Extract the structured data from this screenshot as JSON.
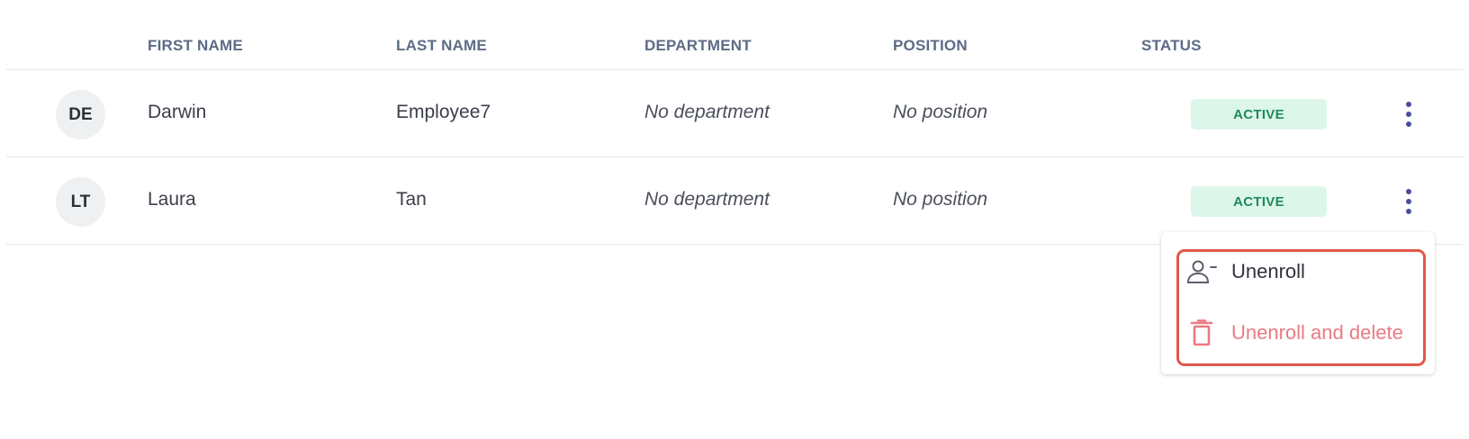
{
  "columns": {
    "first_name": "FIRST NAME",
    "last_name": "LAST NAME",
    "department": "DEPARTMENT",
    "position": "POSITION",
    "status": "STATUS"
  },
  "rows": [
    {
      "initials": "DE",
      "first_name": "Darwin",
      "last_name": "Employee7",
      "department": "No department",
      "position": "No position",
      "status": "ACTIVE"
    },
    {
      "initials": "LT",
      "first_name": "Laura",
      "last_name": "Tan",
      "department": "No department",
      "position": "No position",
      "status": "ACTIVE"
    }
  ],
  "row_menu": {
    "items": [
      {
        "label": "Unenroll",
        "icon": "user-minus-icon"
      },
      {
        "label": "Unenroll and delete",
        "icon": "trash-icon"
      }
    ]
  },
  "colors": {
    "status_active_bg": "#dcf6ea",
    "status_active_text": "#1f8a5a",
    "kebab": "#4a4f9c",
    "danger": "#ea7a82",
    "highlight_outline": "#e0574a"
  }
}
